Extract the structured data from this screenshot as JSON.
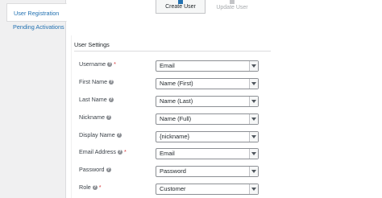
{
  "sidebar": {
    "items": [
      {
        "label": "User Registration",
        "active": true
      },
      {
        "label": "Pending Activations",
        "active": false
      }
    ]
  },
  "modes": {
    "create": "Create User",
    "update": "Update User"
  },
  "settings": {
    "title": "User Settings",
    "fields": [
      {
        "label": "Username",
        "value": "Email"
      },
      {
        "label": "First Name",
        "value": "Name (First)"
      },
      {
        "label": "Last Name",
        "value": "Name (Last)"
      },
      {
        "label": "Nickname",
        "value": "Name (Full)"
      },
      {
        "label": "Display Name",
        "value": "{nickname}"
      },
      {
        "label": "Email Address",
        "value": "Email"
      },
      {
        "label": "Password",
        "value": "Password"
      },
      {
        "label": "Role",
        "value": "Customer"
      }
    ]
  },
  "colors": {
    "accent": "#2271b1",
    "required": "#d63638"
  }
}
